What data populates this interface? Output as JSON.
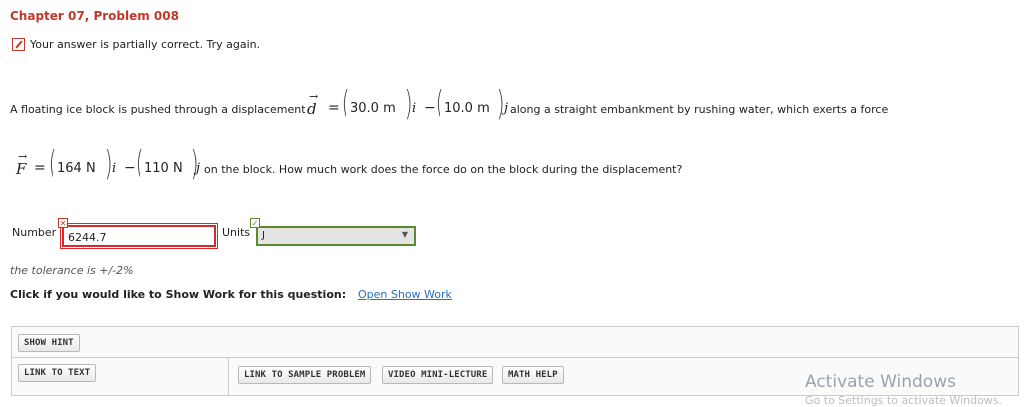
{
  "header": {
    "title": "Chapter 07, Problem 008"
  },
  "feedback": {
    "message": "Your answer is partially correct.  Try again."
  },
  "problem": {
    "line1_intro": "A floating ice block is pushed through a displacement",
    "d_symbol": "d",
    "equals": "=",
    "d_x": "30.0 m",
    "i_hat": "i",
    "minus": "−",
    "d_y": "10.0 m",
    "j_hat": "j",
    "line1_outro": "along a straight embankment by rushing water, which exerts a force",
    "F_symbol": "F",
    "F_x": "164 N",
    "F_y": "110 N",
    "line2_outro": "on the block. How much work does the force do on the block during the displacement?"
  },
  "answer": {
    "number_label": "Number",
    "number_value": "6244.7",
    "units_label": "Units",
    "units_value": "J"
  },
  "tolerance": "the tolerance is +/-2%",
  "show_work": {
    "prompt": "Click if you would like to Show Work for this question:",
    "link": "Open Show Work"
  },
  "resources": {
    "show_hint": "SHOW HINT",
    "link_to_text": "LINK TO TEXT",
    "sample_problem": "LINK TO SAMPLE PROBLEM",
    "video": "VIDEO MINI-LECTURE",
    "math_help": "MATH HELP"
  },
  "watermark": {
    "title": "Activate Windows",
    "subtitle": "Go to Settings to activate Windows."
  },
  "colors": {
    "title": "#c0392b",
    "error": "#d42c2c",
    "correct": "#5a8a2b",
    "link": "#2a6ebb"
  }
}
